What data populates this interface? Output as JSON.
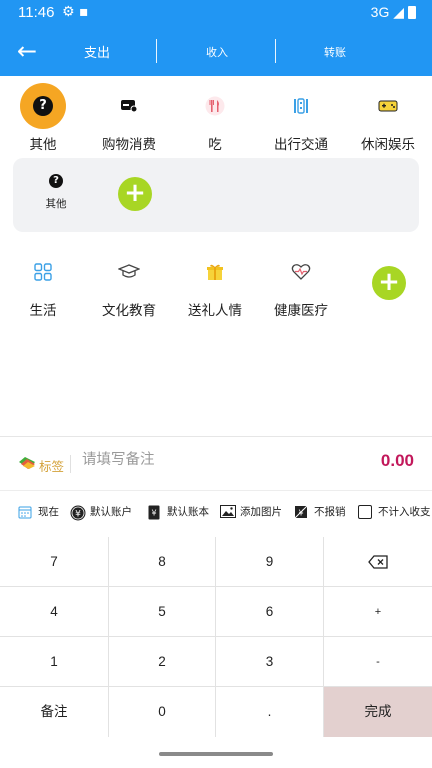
{
  "status_bar": {
    "time": "11:46",
    "network": "3G"
  },
  "toolbar": {
    "tabs": [
      "支出",
      "收入",
      "转账"
    ]
  },
  "categories_row1": [
    {
      "label": "其他",
      "icon": "question-circle-icon",
      "selected": true
    },
    {
      "label": "购物消费",
      "icon": "shopping-card-icon"
    },
    {
      "label": "吃",
      "icon": "fork-knife-icon"
    },
    {
      "label": "出行交通",
      "icon": "transit-icon"
    },
    {
      "label": "休闲娱乐",
      "icon": "gamepad-icon"
    }
  ],
  "subcategory_panel": {
    "items": [
      {
        "label": "其他",
        "icon": "question-circle-icon"
      }
    ]
  },
  "categories_row2": [
    {
      "label": "生活",
      "icon": "grid-icon"
    },
    {
      "label": "文化教育",
      "icon": "graduation-cap-icon"
    },
    {
      "label": "送礼人情",
      "icon": "gift-icon"
    },
    {
      "label": "健康医疗",
      "icon": "heart-pulse-icon"
    }
  ],
  "note_row": {
    "tag_label": "标签",
    "note_placeholder": "请填写备注",
    "amount": "0.00"
  },
  "options": {
    "time": "现在",
    "account": "默认账户",
    "book": "默认账本",
    "add_image": "添加图片",
    "no_reimburse": "不报销",
    "exclude": "不计入收支"
  },
  "keypad": {
    "rows": [
      [
        "7",
        "8",
        "9",
        "⌫"
      ],
      [
        "4",
        "5",
        "6",
        "+"
      ],
      [
        "1",
        "2",
        "3",
        "-"
      ],
      [
        "备注",
        "0",
        ".",
        "完成"
      ]
    ]
  },
  "colors": {
    "primary": "#2196f3",
    "selected": "#f5a623",
    "add_button": "#a8d624",
    "amount": "#c2185b",
    "done_key": "#e3d0cf"
  }
}
